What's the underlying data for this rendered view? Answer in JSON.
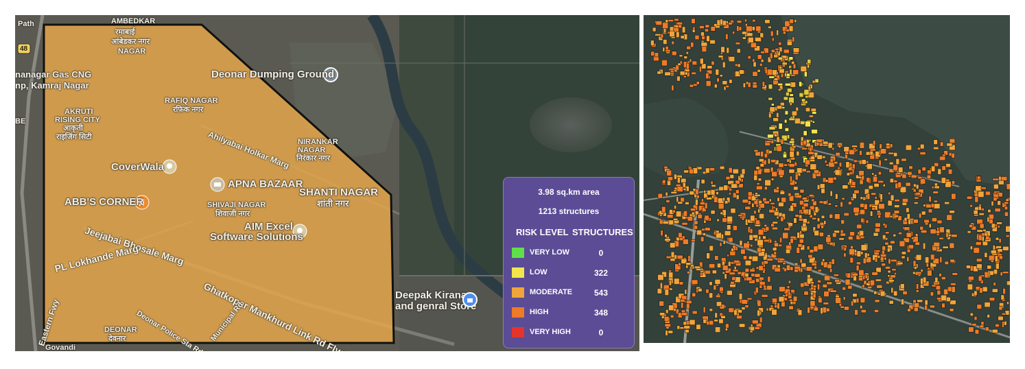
{
  "left_map": {
    "labels": {
      "ambedkar": "AMBEDKAR",
      "ramabai_hi": "रमाबाई",
      "ambedkar_nagar_hi": "आंबेडकर नगर",
      "nagar": "NAGAR",
      "gas_cng": "nanagar Gas CNG",
      "kamraj": "np, Kamraj Nagar",
      "akruti": "AKRUTI",
      "rising_city": "RISING CITY",
      "akruti_hi": "आकृती",
      "rising_city_hi": "राइजिंग सिटी",
      "be": "BE",
      "rafiq": "RAFIQ NAGAR",
      "rafiq_hi": "रफ़िक नगर",
      "deonar_dump": "Deonar Dumping Ground",
      "ahilyabai": "Ahilyabai Holkar Marg",
      "nirankar": "NIRANKAR",
      "nirankar2": "NAGAR",
      "nirankar_hi": "निरंकार नगर",
      "coverwala": "CoverWala",
      "apna": "APNA BAZAAR",
      "shanti": "SHANTI NAGAR",
      "shanti_hi": "शांती नगर",
      "abbs": "ABB'S CORNER",
      "shivaji": "SHIVAJI NAGAR",
      "shivaji_hi": "शिवाजी नगर",
      "aim1": "AIM Excel",
      "aim2": "Software Solutions",
      "jeejabai": "Jeejabai Bhosale Marg",
      "lokhande": "PL Lokhande Marg",
      "ghatkopar": "Ghatkopar Mankhurd Link Rd Flyover",
      "eastern": "Eastern Fwy",
      "deonar_police": "Deonar Police Sta Rd",
      "municipal": "Municipal Rd",
      "deonar": "DEONAR",
      "deonar_hi": "देवनार",
      "deepak1": "Deepak Kirana",
      "deepak2": "and genral Store",
      "highway": "48",
      "path": "Path",
      "govandi": "Govandi"
    }
  },
  "legend": {
    "area": "3.98 sq.km area",
    "structures_total": "1213 structures",
    "col_risk": "RISK LEVEL",
    "col_structures": "STRUCTURES",
    "rows": [
      {
        "label": "VERY LOW",
        "value": "0",
        "color": "#5fe04a"
      },
      {
        "label": "LOW",
        "value": "322",
        "color": "#f2e64c"
      },
      {
        "label": "MODERATE",
        "value": "543",
        "color": "#f0a53a"
      },
      {
        "label": "HIGH",
        "value": "348",
        "color": "#ef7a27"
      },
      {
        "label": "VERY HIGH",
        "value": "0",
        "color": "#e5352a"
      }
    ]
  },
  "colors": {
    "polygon_fill": "#e9a84a",
    "very_low": "#5fe04a",
    "low": "#f2e64c",
    "moderate": "#f0a53a",
    "high": "#ef7a27",
    "very_high": "#e5352a",
    "legend_bg": "#5b4c95"
  }
}
